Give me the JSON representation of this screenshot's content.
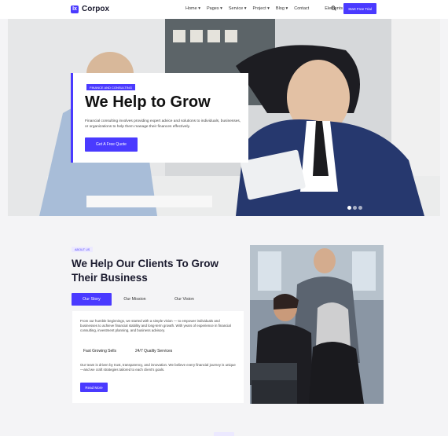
{
  "nav": {
    "brand": "Corpox",
    "brand_mark": "Ix",
    "items": [
      "Home ▾",
      "Pages ▾",
      "Service ▾",
      "Project ▾",
      "Blog ▾",
      "Contact",
      "Elements ▾"
    ],
    "cta": "Start Free Trial"
  },
  "hero": {
    "badge": "FINANCE AND CONSULTING",
    "title": "We Help to Grow",
    "description": "Financial consulting involves providing expert advice and solutions to individuals, businesses, or organizations to help them manage their finances effectively.",
    "button": "Get A Free Quote"
  },
  "about": {
    "badge": "ABOUT US",
    "title": "We Help Our Clients To Grow Their Business",
    "tabs": [
      "Our Story",
      "Our Mission",
      "Our Vision"
    ],
    "paragraph1": "From our humble beginnings, we started with a simple vision — to empower individuals and businesses to achieve financial stability and long-term growth. With years of experience in financial consulting, investment planning, and business advisory.",
    "features": [
      "Fast Growing Sells",
      "24/7 Quality Services"
    ],
    "paragraph2": "Our team is driven by trust, transparency, and innovation. We believe every financial journey is unique—and we craft strategies tailored to each client's goals.",
    "button": "Read More"
  },
  "colors": {
    "accent": "#4a3aff",
    "background": "#f4f4f6"
  }
}
